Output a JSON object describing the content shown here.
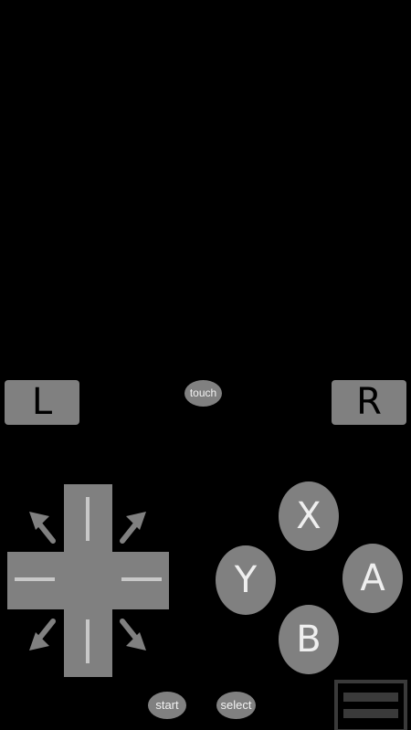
{
  "shoulders": {
    "left_label": "L",
    "right_label": "R"
  },
  "system": {
    "touch_label": "touch",
    "start_label": "start",
    "select_label": "select"
  },
  "face_buttons": {
    "x": "X",
    "y": "Y",
    "a": "A",
    "b": "B"
  },
  "icons": {
    "dpad": "dpad-icon",
    "diagonal": "diagonal-arrow-icon",
    "menu": "menu-icon"
  },
  "colors": {
    "background": "#000000",
    "button_fill": "#808080",
    "button_text": "#f0f0f0",
    "dpad_mark": "#c8c8c8"
  }
}
